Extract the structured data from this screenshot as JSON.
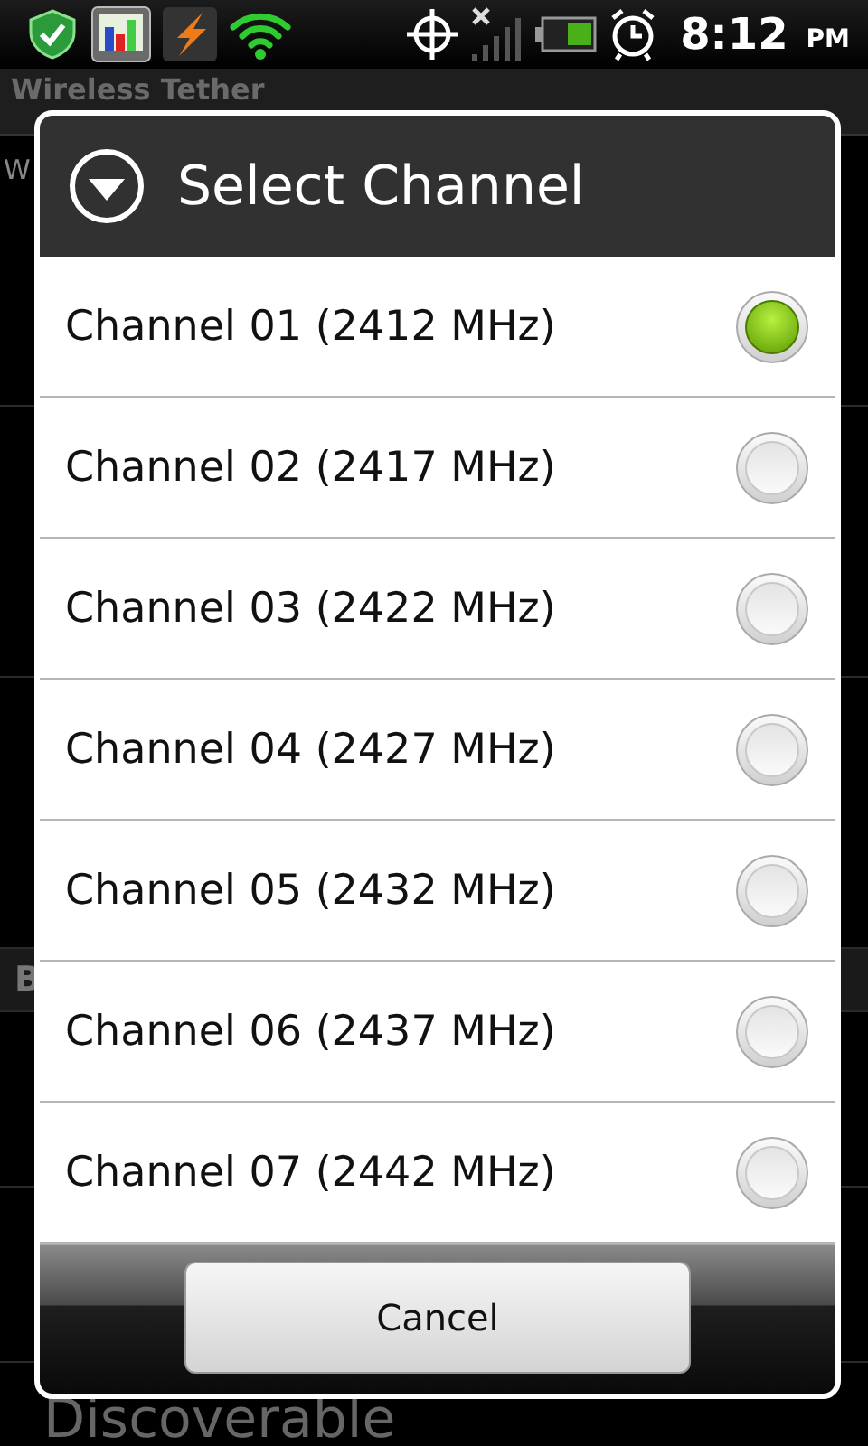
{
  "status_bar": {
    "time": "8:12",
    "meridiem": "PM"
  },
  "background": {
    "header": "Wireless Tether",
    "rows": [
      {
        "kind": "item",
        "text": "W"
      },
      {
        "kind": "item",
        "text": ""
      },
      {
        "kind": "item",
        "text": ""
      },
      {
        "kind": "category",
        "text": "B"
      },
      {
        "kind": "item",
        "text": ""
      },
      {
        "kind": "item",
        "text": ""
      },
      {
        "kind": "item",
        "text": "Discoverable"
      }
    ]
  },
  "dialog": {
    "title": "Select Channel",
    "options": [
      {
        "label": "Channel 01 (2412 MHz)",
        "selected": true
      },
      {
        "label": "Channel 02 (2417 MHz)",
        "selected": false
      },
      {
        "label": "Channel 03 (2422 MHz)",
        "selected": false
      },
      {
        "label": "Channel 04 (2427 MHz)",
        "selected": false
      },
      {
        "label": "Channel 05 (2432 MHz)",
        "selected": false
      },
      {
        "label": "Channel 06 (2437 MHz)",
        "selected": false
      },
      {
        "label": "Channel 07 (2442 MHz)",
        "selected": false
      }
    ],
    "button": "Cancel"
  }
}
